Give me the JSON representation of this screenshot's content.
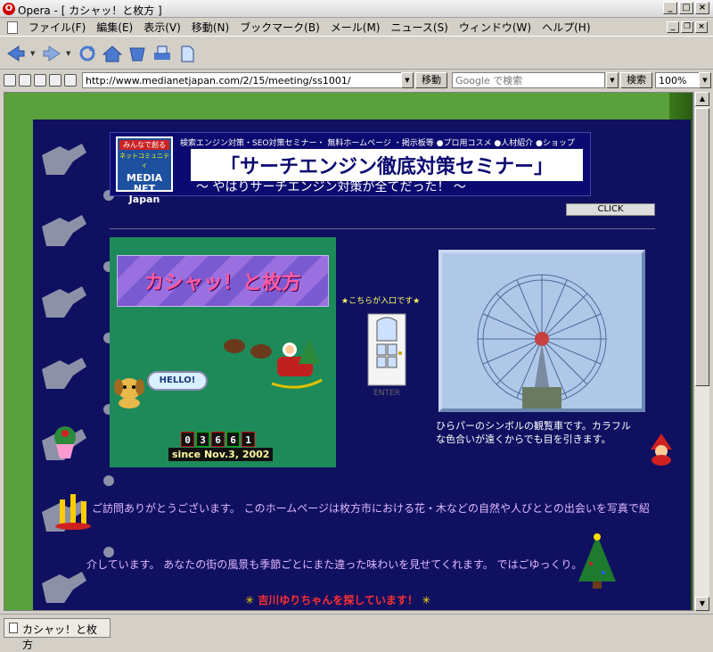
{
  "window": {
    "title": "Opera - [ カシャッ！と枚方 ]",
    "logo": "O"
  },
  "menu": {
    "items": [
      "ファイル(F)",
      "編集(E)",
      "表示(V)",
      "移動(N)",
      "ブックマーク(B)",
      "メール(M)",
      "ニュース(S)",
      "ウィンドウ(W)",
      "ヘルプ(H)"
    ]
  },
  "address": {
    "url": "http://www.medianetjapan.com/2/15/meeting/ss1001/",
    "go_label": "移動",
    "search_placeholder": "Google で検索",
    "search_label": "検索",
    "zoom": "100%"
  },
  "banner": {
    "logo_top": "みんなで創る",
    "logo_sub": "ネットコミュニティ",
    "logo_main": "MEDIA NET Japan",
    "links": "検索エンジン対策・SEO対策セミナー・ 無料ホームページ ・掲示板等 ●プロ用コスメ ●人材紹介 ●ショップ",
    "headline": "「サーチエンジン徹底対策セミナー」",
    "sub": "〜 やはりサーチエンジン対策が全てだった！ 〜",
    "click": "CLICK"
  },
  "site": {
    "title": "カシャッ！と枚方",
    "hello": "HELLO!",
    "counter": [
      "0",
      "3",
      "6",
      "6",
      "1"
    ],
    "since": "since Nov.3, 2002",
    "entrance": "★こちらが入口です★",
    "enter": "ENTER",
    "photo_caption": "ひらパーのシンボルの観覧車です。カラフル\nな色合いが遠くからでも目を引きます。",
    "intro1": "ご訪問ありがとうございます。 このホームページは枚方市における花・木などの自然や人びととの出会いを写真で紹",
    "intro2": "介しています。 あなたの街の風景も季節ごとにまた違った味わいを見せてくれます。 ではごゆっくり。",
    "search_notice": "吉川ゆりちゃんを探しています！"
  },
  "status": {
    "tab_title": "カシャッ！と枚方"
  },
  "colors": {
    "page_bg": "#5aa03c",
    "panel_bg": "#0f1060",
    "green_box": "#1e8a5a"
  }
}
